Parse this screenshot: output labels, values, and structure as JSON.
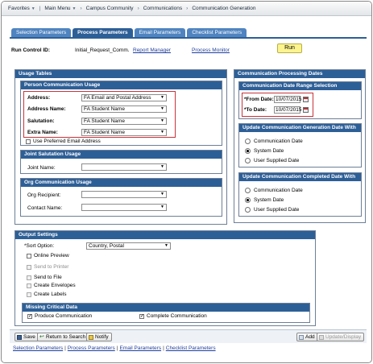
{
  "breadcrumb": {
    "items": [
      "Favorites",
      "Main Menu",
      "Campus Community",
      "Communications",
      "Communication Generation"
    ]
  },
  "tabs": [
    {
      "label": "Selection Parameters",
      "active": false
    },
    {
      "label": "Process Parameters",
      "active": true
    },
    {
      "label": "Email Parameters",
      "active": false
    },
    {
      "label": "Checklist Parameters",
      "active": false
    }
  ],
  "run_control": {
    "label": "Run Control ID:",
    "value": "Initial_Request_Comm.",
    "report_manager": "Report Manager",
    "process_monitor": "Process Monitor",
    "run_button": "Run"
  },
  "usage_tables": {
    "title": "Usage Tables",
    "person_usage": {
      "title": "Person Communication Usage",
      "address_label": "Address:",
      "address_value": "FA Email and Postal Address",
      "address_name_label": "Address Name:",
      "address_name_value": "FA Student Name",
      "salutation_label": "Salutation:",
      "salutation_value": "FA Student Name",
      "extra_name_label": "Extra Name:",
      "extra_name_value": "FA Student Name",
      "preferred_email_label": "Use Preferred Email Address",
      "preferred_email_checked": false
    },
    "joint_salutation": {
      "title": "Joint Salutation Usage",
      "joint_name_label": "Joint Name:",
      "joint_name_value": ""
    },
    "org_usage": {
      "title": "Org Communication Usage",
      "org_recipient_label": "Org Recipient:",
      "org_recipient_value": "",
      "contact_name_label": "Contact Name:",
      "contact_name_value": ""
    }
  },
  "processing_dates": {
    "title": "Communication Processing Dates",
    "date_range": {
      "title": "Communication Date Range Selection",
      "from_label": "*From Date:",
      "from_value": "10/07/2015",
      "to_label": "*To Date:",
      "to_value": "10/07/2015"
    },
    "generation_date": {
      "title": "Update Communication Generation Date With",
      "options": [
        "Communication Date",
        "System Date",
        "User Supplied Date"
      ],
      "selected": "System Date"
    },
    "completed_date": {
      "title": "Update Communication Completed Date With",
      "options": [
        "Communication Date",
        "System Date",
        "User Supplied Date"
      ],
      "selected": "System Date"
    }
  },
  "output_settings": {
    "title": "Output Settings",
    "sort_label": "*Sort Option:",
    "sort_value": "Country, Postal",
    "online_preview": "Online Preview",
    "send_to_printer": "Send to Printer",
    "send_to_file": "Send to File",
    "create_envelopes": "Create Envelopes",
    "create_labels": "Create Labels",
    "missing_data": {
      "title": "Missing Critical Data",
      "produce_label": "Produce Communication",
      "produce_checked": true,
      "complete_label": "Complete Communication",
      "complete_checked": true
    }
  },
  "toolbar": {
    "save": "Save",
    "return_to_search": "Return to Search",
    "notify": "Notify",
    "add": "Add",
    "update_display": "Update/Display"
  },
  "footer_links": [
    "Selection Parameters",
    "Process Parameters",
    "Email Parameters",
    "Checklist Parameters"
  ],
  "colors": {
    "panel_header": "#2d5f97",
    "tab": "#4f84c0",
    "highlight_box": "#c8333a",
    "run_button": "#fbf48f",
    "link": "#1f3f9c"
  }
}
